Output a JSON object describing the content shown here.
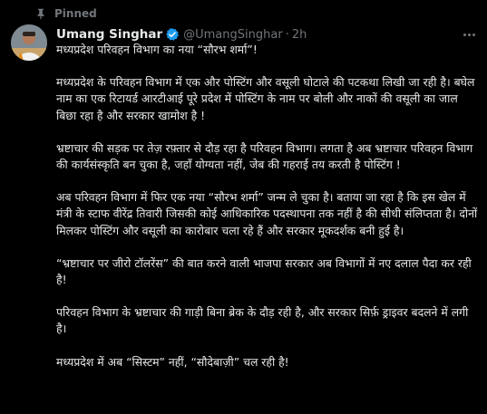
{
  "pinned_label": "Pinned",
  "author": {
    "name": "Umang Singhar",
    "handle": "@UmangSinghar",
    "separator": "·",
    "time": "2h"
  },
  "paragraphs": [
    "मध्यप्रदेश परिवहन विभाग का नया “सौरभ शर्मा”!",
    "मध्यप्रदेश के परिवहन विभाग में एक और पोस्टिंग और वसूली घोटाले की पटकथा लिखी जा रही है। बघेल नाम का एक रिटायर्ड आरटीआई पूरे प्रदेश में पोस्टिंग के नाम पर बोली और नाकों की वसूली का जाल बिछा रहा है और सरकार खामोश है !",
    "भ्रष्टाचार की सड़क पर तेज़ रफ़्तार से दौड़ रहा है परिवहन विभाग। लगता है अब भ्रष्टाचार परिवहन विभाग की कार्यसंस्कृति बन चुका है, जहाँ योग्यता नहीं, जेब की गहराई तय करती है पोस्टिंग !",
    "अब परिवहन विभाग में फिर एक नया “सौरभ शर्मा” जन्म ले चुका है। बताया जा रहा है कि इस खेल में मंत्री के स्टाफ वीरेंद्र तिवारी जिसकी कोई आधिकारिक पदस्थापना तक नहीं है की सीधी संलिप्तता है। दोनों मिलकर पोस्टिंग और वसूली का कारोबार चला रहे हैं और सरकार मूकदर्शक बनी हुई है।",
    "“भ्रष्टाचार पर जीरो टॉलरेंस” की बात करने वाली भाजपा सरकार अब विभागों में नए दलाल पैदा कर रही है!",
    "परिवहन विभाग के भ्रष्टाचार की गाड़ी बिना ब्रेक के दौड़ रही है, और सरकार सिर्फ़ ड्राइवर बदलने में लगी है।",
    "मध्यप्रदेश में अब “सिस्टम” नहीं, “सौदेबाज़ी” चल रही है!"
  ],
  "colors": {
    "background": "#000000",
    "text": "#e7e9ea",
    "muted": "#71767b",
    "verified": "#1d9bf0"
  },
  "icons": [
    "pin-icon",
    "verified-badge-icon",
    "more-options-icon",
    "avatar"
  ]
}
